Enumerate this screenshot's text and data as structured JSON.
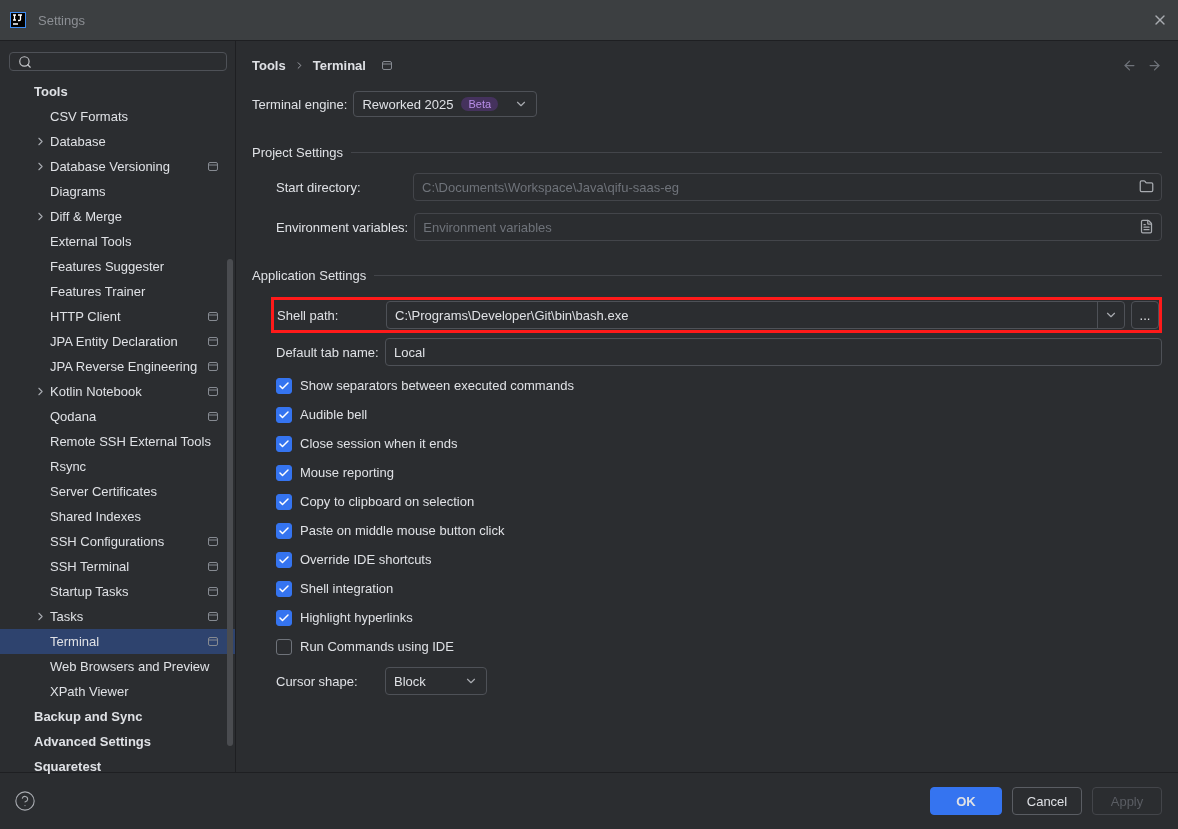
{
  "window": {
    "title": "Settings"
  },
  "sidebar": {
    "items": [
      {
        "label": "Tools",
        "kind": "section",
        "selected": false
      },
      {
        "label": "CSV Formats",
        "kind": "page",
        "has_children": false,
        "project": false,
        "selected": false
      },
      {
        "label": "Database",
        "kind": "page",
        "has_children": true,
        "project": false,
        "selected": false
      },
      {
        "label": "Database Versioning",
        "kind": "page",
        "has_children": true,
        "project": true,
        "selected": false
      },
      {
        "label": "Diagrams",
        "kind": "page",
        "has_children": false,
        "project": false,
        "selected": false
      },
      {
        "label": "Diff & Merge",
        "kind": "page",
        "has_children": true,
        "project": false,
        "selected": false
      },
      {
        "label": "External Tools",
        "kind": "page",
        "has_children": false,
        "project": false,
        "selected": false
      },
      {
        "label": "Features Suggester",
        "kind": "page",
        "has_children": false,
        "project": false,
        "selected": false
      },
      {
        "label": "Features Trainer",
        "kind": "page",
        "has_children": false,
        "project": false,
        "selected": false
      },
      {
        "label": "HTTP Client",
        "kind": "page",
        "has_children": false,
        "project": true,
        "selected": false
      },
      {
        "label": "JPA Entity Declaration",
        "kind": "page",
        "has_children": false,
        "project": true,
        "selected": false
      },
      {
        "label": "JPA Reverse Engineering",
        "kind": "page",
        "has_children": false,
        "project": true,
        "selected": false
      },
      {
        "label": "Kotlin Notebook",
        "kind": "page",
        "has_children": true,
        "project": true,
        "selected": false
      },
      {
        "label": "Qodana",
        "kind": "page",
        "has_children": false,
        "project": true,
        "selected": false
      },
      {
        "label": "Remote SSH External Tools",
        "kind": "page",
        "has_children": false,
        "project": false,
        "selected": false
      },
      {
        "label": "Rsync",
        "kind": "page",
        "has_children": false,
        "project": false,
        "selected": false
      },
      {
        "label": "Server Certificates",
        "kind": "page",
        "has_children": false,
        "project": false,
        "selected": false
      },
      {
        "label": "Shared Indexes",
        "kind": "page",
        "has_children": false,
        "project": false,
        "selected": false
      },
      {
        "label": "SSH Configurations",
        "kind": "page",
        "has_children": false,
        "project": true,
        "selected": false
      },
      {
        "label": "SSH Terminal",
        "kind": "page",
        "has_children": false,
        "project": true,
        "selected": false
      },
      {
        "label": "Startup Tasks",
        "kind": "page",
        "has_children": false,
        "project": true,
        "selected": false
      },
      {
        "label": "Tasks",
        "kind": "page",
        "has_children": true,
        "project": true,
        "selected": false
      },
      {
        "label": "Terminal",
        "kind": "page",
        "has_children": false,
        "project": true,
        "selected": true
      },
      {
        "label": "Web Browsers and Preview",
        "kind": "page",
        "has_children": false,
        "project": false,
        "selected": false
      },
      {
        "label": "XPath Viewer",
        "kind": "page",
        "has_children": false,
        "project": false,
        "selected": false
      },
      {
        "label": "Backup and Sync",
        "kind": "section",
        "selected": false
      },
      {
        "label": "Advanced Settings",
        "kind": "section",
        "selected": false
      },
      {
        "label": "Squaretest",
        "kind": "section",
        "selected": false
      }
    ]
  },
  "breadcrumb": [
    "Tools",
    "Terminal"
  ],
  "engine": {
    "label": "Terminal engine:",
    "value": "Reworked 2025",
    "badge": "Beta"
  },
  "project_settings": {
    "title": "Project Settings",
    "fields": [
      {
        "label": "Start directory:",
        "placeholder": "C:\\Documents\\Workspace\\Java\\qifu-saas-eg",
        "kind": "folder"
      },
      {
        "label": "Environment variables:",
        "placeholder": "Environment variables",
        "kind": "list"
      }
    ]
  },
  "application_settings": {
    "title": "Application Settings",
    "shell_path": {
      "label": "Shell path:",
      "value": "C:\\Programs\\Developer\\Git\\bin\\bash.exe",
      "browse": "...",
      "highlighted": true
    },
    "default_tab_name": {
      "label": "Default tab name:",
      "value": "Local"
    },
    "options": [
      {
        "label": "Show separators between executed commands",
        "checked": true
      },
      {
        "label": "Audible bell",
        "checked": true
      },
      {
        "label": "Close session when it ends",
        "checked": true
      },
      {
        "label": "Mouse reporting",
        "checked": true
      },
      {
        "label": "Copy to clipboard on selection",
        "checked": true
      },
      {
        "label": "Paste on middle mouse button click",
        "checked": true
      },
      {
        "label": "Override IDE shortcuts",
        "checked": true
      },
      {
        "label": "Shell integration",
        "checked": true
      },
      {
        "label": "Highlight hyperlinks",
        "checked": true
      },
      {
        "label": "Run Commands using IDE",
        "checked": false
      }
    ],
    "cursor_shape": {
      "label": "Cursor shape:",
      "value": "Block"
    }
  },
  "buttons": [
    {
      "label": "OK",
      "kind": "primary"
    },
    {
      "label": "Cancel",
      "kind": "normal"
    },
    {
      "label": "Apply",
      "kind": "disabled"
    }
  ]
}
